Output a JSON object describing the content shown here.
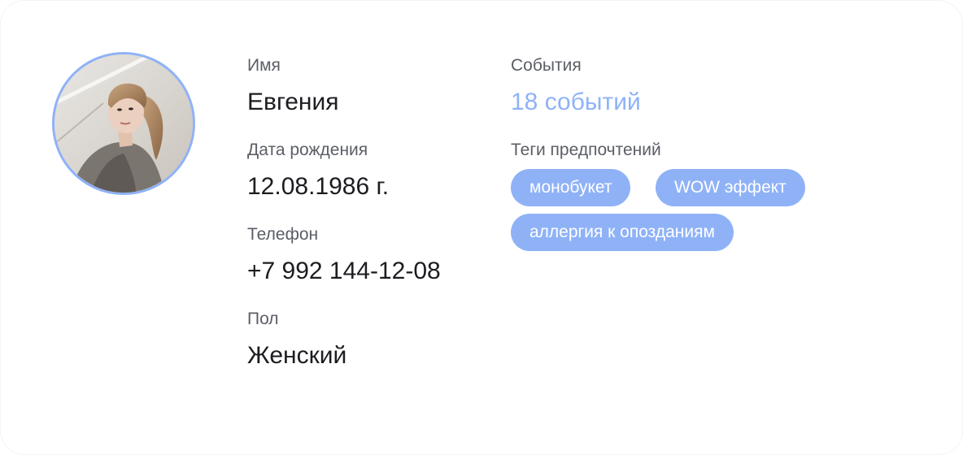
{
  "profile": {
    "name_label": "Имя",
    "name_value": "Евгения",
    "birth_label": "Дата рождения",
    "birth_value": "12.08.1986 г.",
    "phone_label": "Телефон",
    "phone_value": "+7 992 144-12-08",
    "gender_label": "Пол",
    "gender_value": "Женский"
  },
  "events": {
    "label": "События",
    "value": "18 событий"
  },
  "tags": {
    "label": "Теги предпочтений",
    "items": [
      "монобукет",
      "WOW эффект",
      "аллергия к опозданиям"
    ]
  },
  "colors": {
    "accent": "#8fb2f7",
    "label_text": "#5b5e66",
    "value_text": "#1c1d21"
  }
}
